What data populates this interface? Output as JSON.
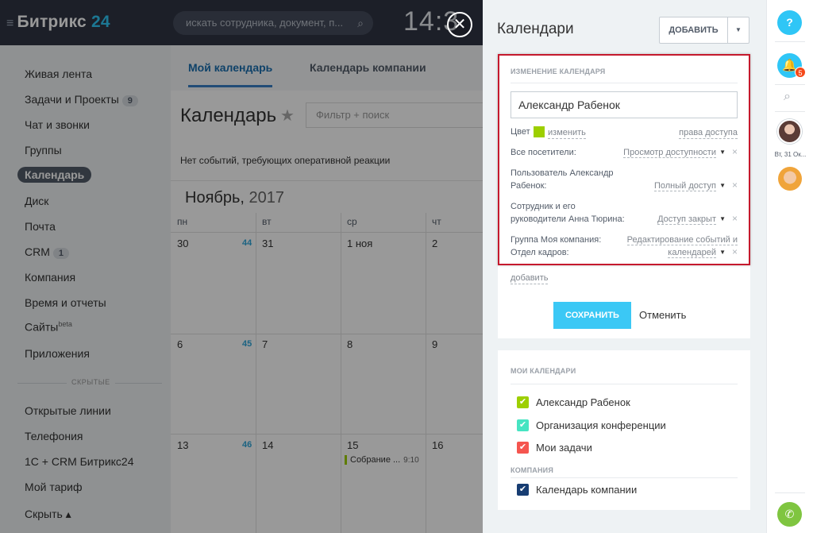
{
  "topbar": {
    "logo_main": "Битрикс",
    "logo_num": "24",
    "search_placeholder": "искать сотрудника, документ, п...",
    "clock": "14:3"
  },
  "leftmenu": {
    "items": [
      {
        "label": "Живая лента"
      },
      {
        "label": "Задачи и Проекты",
        "badge": "9"
      },
      {
        "label": "Чат и звонки"
      },
      {
        "label": "Группы"
      },
      {
        "label": "Календарь",
        "active": true
      },
      {
        "label": "Диск"
      },
      {
        "label": "Почта"
      },
      {
        "label": "CRM",
        "badge": "1"
      },
      {
        "label": "Компания"
      },
      {
        "label": "Время и отчеты"
      },
      {
        "label": "Сайты",
        "sup": "beta"
      },
      {
        "label": "Приложения"
      }
    ],
    "hidden_label": "СКРЫТЫЕ",
    "hidden_items": [
      {
        "label": "Открытые линии"
      },
      {
        "label": "Телефония"
      },
      {
        "label": "1С + CRM Битрикс24"
      },
      {
        "label": "Мой тариф"
      },
      {
        "label": "Скрыть ▴"
      }
    ]
  },
  "calendar": {
    "tabs": [
      "Мой календарь",
      "Календарь компании"
    ],
    "title": "Календарь",
    "filter_placeholder": "Фильтр + поиск",
    "no_events": "Нет событий, требующих оперативной реакции",
    "month": "Ноябрь,",
    "year": "2017",
    "weekdays": [
      "пн",
      "вт",
      "ср",
      "чт"
    ],
    "rows": [
      {
        "week": "44",
        "days": [
          "30",
          "31",
          "1 ноя",
          "2"
        ]
      },
      {
        "week": "45",
        "days": [
          "6",
          "7",
          "8",
          "9"
        ]
      },
      {
        "week": "46",
        "days": [
          "13",
          "14",
          "15",
          "16"
        ]
      }
    ],
    "event": {
      "title": "Собрание ...",
      "time": "9:10"
    }
  },
  "panel": {
    "title": "Календари",
    "add_label": "ДОБАВИТЬ",
    "edit_section": "ИЗМЕНЕНИЕ КАЛЕНДАРЯ",
    "name_value": "Александр Рабенок",
    "color_label": "Цвет",
    "color_change": "изменить",
    "access_rights": "права доступа",
    "rows": [
      {
        "who": "Все посетители:",
        "access": "Просмотр доступности"
      },
      {
        "who1": "Пользователь Александр",
        "who2": "Рабенок:",
        "access": "Полный доступ"
      },
      {
        "who1": "Сотрудник и его",
        "who2": "руководители Анна Тюрина:",
        "access": "Доступ закрыт"
      },
      {
        "who1": "Группа Моя компания:",
        "who2": "Отдел кадров:",
        "access1": "Редактирование событий и",
        "access2": "календарей"
      }
    ],
    "add_link": "добавить",
    "save_label": "СОХРАНИТЬ",
    "cancel_label": "Отменить",
    "my_calendars_title": "МОИ КАЛЕНДАРИ",
    "my_calendars": [
      {
        "label": "Александр Рабенок",
        "color": "#9dcf00"
      },
      {
        "label": "Организация конференции",
        "color": "#47e4c2"
      },
      {
        "label": "Мои задачи",
        "color": "#f5554f"
      }
    ],
    "company_title": "КОМПАНИЯ",
    "company_calendars": [
      {
        "label": "Календарь компании",
        "color": "#173d72"
      }
    ]
  },
  "rightbar": {
    "help": "?",
    "bell_badge": "5",
    "date_label": "Вт, 31 Ок..."
  },
  "colors": {
    "accent": "#2fc6f6",
    "highlight": "#c5192d",
    "event_green": "#9dcf00"
  }
}
